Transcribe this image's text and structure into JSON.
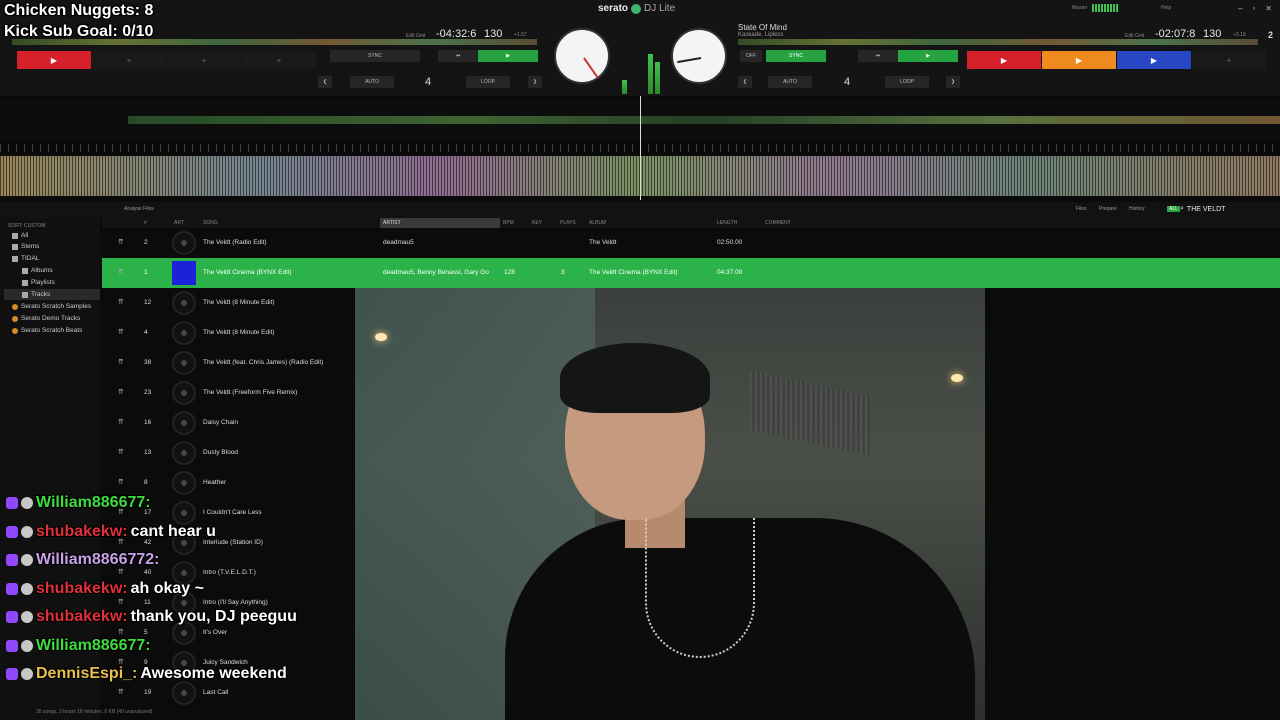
{
  "overlay": {
    "chicken_nuggets": "Chicken Nuggets: 8",
    "kick_goal": "Kick Sub Goal: 0/10"
  },
  "app": {
    "brand": "serato",
    "product": "DJ Lite",
    "master_label": "Master",
    "help_label": "Help",
    "deck2_num": "2"
  },
  "deck_left": {
    "time": "-04:32:6",
    "bpm": "130",
    "bpm_offset": "+1.57",
    "edit_grid": "Edit Grid",
    "sync": "SYNC",
    "auto": "AUTO",
    "loop": "LOOP",
    "loop_num": "4"
  },
  "deck_right": {
    "title": "State Of Mind",
    "artist": "Kaskade, Lipless",
    "time": "-02:07:8",
    "bpm": "130",
    "bpm_offset": "+3.19",
    "edit_grid": "Edit Grid",
    "off": "OFF",
    "sync": "SYNC",
    "auto": "AUTO",
    "loop": "LOOP",
    "loop_num": "4"
  },
  "pads": {
    "plus": "+",
    "play": "▶"
  },
  "colors": {
    "pad_red": "#d6202a",
    "pad_orange": "#ef8a1e",
    "pad_blue": "#2747c4",
    "pad_green": "#27a340",
    "row_highlight": "#2bb34a"
  },
  "library": {
    "analyse_files": "Analyse Files",
    "files": "Files",
    "prepare": "Prepare",
    "history": "History",
    "all_btn": "ALL",
    "search": "THE VELDT",
    "sort_custom": "SORT: CUSTOM",
    "sidebar": [
      "All",
      "Stems",
      "TIDAL",
      "Albums",
      "Playlists",
      "Tracks",
      "Serato Scratch Samples",
      "Serato Demo Tracks",
      "Serato Scratch Beats"
    ],
    "columns": {
      "hash": "#",
      "art": "ART",
      "song": "SONG",
      "artist": "ARTIST",
      "bpm": "BPM",
      "key": "KEY",
      "plays": "PLAYS",
      "album": "ALBUM",
      "length": "LENGTH",
      "comment": "COMMENT"
    },
    "rows": [
      {
        "num": "2",
        "song": "The Veldt (Radio Edit)",
        "artist": "deadmau5",
        "bpm": "",
        "plays": "",
        "album": "The Veldt",
        "length": "02:50.00"
      },
      {
        "num": "1",
        "song": "The Veldt Cinema (BYNX Edit)",
        "artist": "deadmau5, Benny Benassi, Gary Go",
        "bpm": "128",
        "plays": "3",
        "album": "The Veldt Cinema (BYNX Edit)",
        "length": "04:37.00"
      },
      {
        "num": "12",
        "song": "The Veldt (8 Minute Edit)",
        "artist": "",
        "bpm": "",
        "plays": "",
        "album": "",
        "length": ""
      },
      {
        "num": "4",
        "song": "The Veldt (8 Minute Edit)",
        "artist": "",
        "bpm": "",
        "plays": "",
        "album": "",
        "length": ""
      },
      {
        "num": "38",
        "song": "The Veldt (feat. Chris James) (Radio Edit)",
        "artist": "",
        "bpm": "",
        "plays": "",
        "album": "",
        "length": ""
      },
      {
        "num": "23",
        "song": "The Veldt (Freeform Five Remix)",
        "artist": "",
        "bpm": "",
        "plays": "",
        "album": "",
        "length": ""
      },
      {
        "num": "16",
        "song": "Daisy Chain",
        "artist": "",
        "bpm": "",
        "plays": "",
        "album": "",
        "length": ""
      },
      {
        "num": "13",
        "song": "Dusty Blood",
        "artist": "",
        "bpm": "",
        "plays": "",
        "album": "",
        "length": ""
      },
      {
        "num": "8",
        "song": "Heather",
        "artist": "",
        "bpm": "",
        "plays": "",
        "album": "",
        "length": ""
      },
      {
        "num": "17",
        "song": "I Couldn't Care Less",
        "artist": "",
        "bpm": "",
        "plays": "",
        "album": "",
        "length": ""
      },
      {
        "num": "42",
        "song": "Interlude (Station ID)",
        "artist": "",
        "bpm": "",
        "plays": "",
        "album": "",
        "length": ""
      },
      {
        "num": "40",
        "song": "Intro (T.V.E.L.D.T.)",
        "artist": "",
        "bpm": "",
        "plays": "",
        "album": "",
        "length": ""
      },
      {
        "num": "11",
        "song": "Intro (I'll Say Anything)",
        "artist": "",
        "bpm": "",
        "plays": "",
        "album": "",
        "length": ""
      },
      {
        "num": "5",
        "song": "It's Over",
        "artist": "",
        "bpm": "",
        "plays": "",
        "album": "",
        "length": ""
      },
      {
        "num": "9",
        "song": "Juicy Sandwich",
        "artist": "",
        "bpm": "",
        "plays": "",
        "album": "",
        "length": ""
      },
      {
        "num": "19",
        "song": "Last Call",
        "artist": "",
        "bpm": "",
        "plays": "",
        "album": "",
        "length": ""
      }
    ],
    "status": "30 songs, 3 hours 18 minutes, 0 KB (49 unanalyzed)"
  },
  "chat": [
    {
      "name": "William886677:",
      "color": "#3fdc3f",
      "msg": ""
    },
    {
      "name": "shubakekw:",
      "color": "#e0303a",
      "msg": "cant hear u"
    },
    {
      "name": "William8866772:",
      "color": "#c8a0e8",
      "msg": ""
    },
    {
      "name": "shubakekw:",
      "color": "#e0303a",
      "msg": "ah okay ~"
    },
    {
      "name": "shubakekw:",
      "color": "#e0303a",
      "msg": "thank you, DJ peeguu"
    },
    {
      "name": "William886677:",
      "color": "#3fdc3f",
      "msg": ""
    },
    {
      "name": "DennisEspi_:",
      "color": "#e8c04a",
      "msg": "Awesome weekend"
    }
  ]
}
